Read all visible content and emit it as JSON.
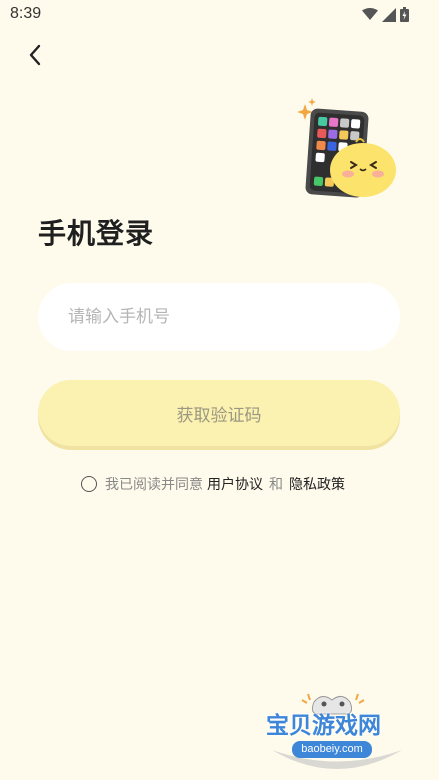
{
  "status_bar": {
    "time": "8:39",
    "icons": [
      "wifi-icon",
      "signal-icon",
      "battery-icon"
    ]
  },
  "header": {
    "back_icon": "chevron-left-icon"
  },
  "page": {
    "title": "手机登录",
    "illustration": "phone-and-chick-mascot"
  },
  "form": {
    "phone_placeholder": "请输入手机号",
    "phone_value": "",
    "submit_label": "获取验证码",
    "agreement": {
      "checked": false,
      "prefix": "我已阅读并同意",
      "user_agreement": "用户协议",
      "and": "和",
      "privacy_policy": "隐私政策"
    }
  },
  "watermark": {
    "text": "宝贝游戏网",
    "sub": "baobeiy.com"
  },
  "colors": {
    "background": "#FFFBEC",
    "button": "#FBF1B0",
    "button_text": "#9B9781",
    "input_bg": "#FFFFFF"
  }
}
